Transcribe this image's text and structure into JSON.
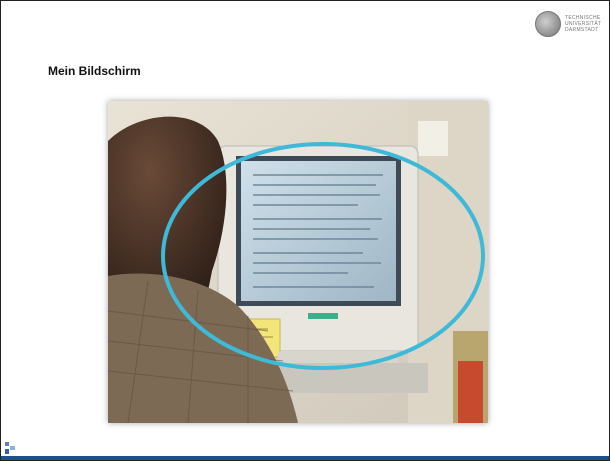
{
  "slide": {
    "title": "Mein Bildschirm",
    "logo": {
      "text": "TECHNISCHE\nUNIVERSITÄT\nDARMSTADT",
      "icon": "university-seal-icon"
    },
    "photo_alt": "Person sitzt vor einem Röhrenmonitor, Bildschirm markiert",
    "highlight_color": "#3fb9d8",
    "footer_color": "#1f4e8c",
    "corner_icon": "presentation-nav-icon"
  }
}
